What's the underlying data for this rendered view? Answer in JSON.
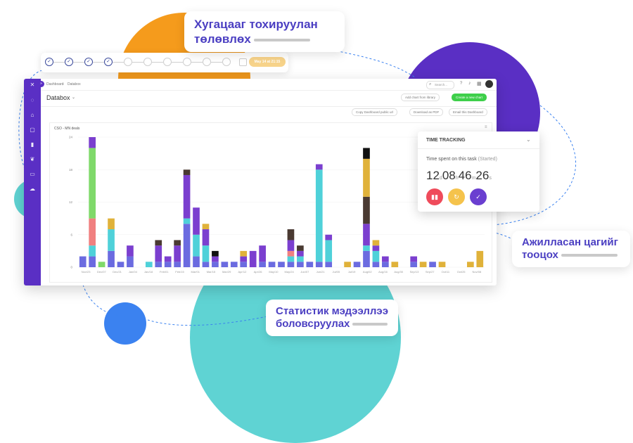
{
  "callouts": {
    "plan_line1": "Хугацааг тохируулан",
    "plan_line2": "төлөвлөх",
    "track_line1": "Ажилласан цагийг",
    "track_line2": "тооцох",
    "stats_line1": "Статистик мэдээллээ",
    "stats_line2": "боловсруулах"
  },
  "stepper": {
    "completed_steps": 4,
    "total_steps": 10,
    "date_badge": "May 14 at 21:15"
  },
  "app": {
    "breadcrumb": [
      "Dashboard",
      "Databox"
    ],
    "search_placeholder": "Search...",
    "page_title": "Databox",
    "add_chart_label": "Add chart from library",
    "create_chart_label": "Create a new chart",
    "copy_link_label": "Copy Dashboard public url",
    "download_pdf_label": "Download as PDF",
    "email_label": "Email this Dashboard"
  },
  "time_tracking": {
    "header": "TIME TRACKING",
    "spent_label": "Time spent on this task",
    "status": "(Started)",
    "days": "12",
    "days_unit": "d",
    "hours": "08",
    "hours_unit": "h",
    "minutes": "46",
    "minutes_unit": "m",
    "seconds": "26",
    "seconds_unit": "s"
  },
  "colors": {
    "accent_purple": "#5a2fc4",
    "green_button": "#3ecf4a",
    "stop_red": "#ef4b5b",
    "pause_yellow": "#f5c34c",
    "done_purple": "#6a3fd0"
  },
  "chart_data": {
    "type": "bar",
    "stacked": true,
    "title": "CSO - MN deals",
    "ylim": [
      0,
      24
    ],
    "yticks": [
      0,
      6,
      12,
      18,
      24
    ],
    "xticklabels": [
      "Nov/23",
      "Dec/07",
      "Dec/21",
      "Jan/04",
      "Jan/18",
      "Feb/01",
      "Feb/15",
      "Mar/01",
      "Mar/15",
      "Mar/29",
      "Apr/12",
      "Apr/26",
      "May/10",
      "May/24",
      "Jun/07",
      "Jun/21",
      "Jul/05",
      "Jul/19",
      "Aug/02",
      "Aug/16",
      "Aug/30",
      "Sep/13",
      "Sep/27",
      "Oct/11",
      "Oct/25",
      "Nov/08"
    ],
    "series_colors": [
      "#6b6be0",
      "#4fd1d9",
      "#f08080",
      "#7fd96a",
      "#7b3fcf",
      "#4a3a32",
      "#e0b23a",
      "#111111"
    ],
    "bars": [
      [
        2,
        0,
        0,
        0,
        0,
        0,
        0,
        0
      ],
      [
        2,
        2,
        5,
        13,
        2,
        0,
        0,
        0
      ],
      [
        0,
        0,
        0,
        1,
        0,
        0,
        0,
        0
      ],
      [
        3,
        4,
        0,
        0,
        0,
        0,
        2,
        0
      ],
      [
        1,
        0,
        0,
        0,
        0,
        0,
        0,
        0
      ],
      [
        2,
        0,
        0,
        0,
        2,
        0,
        0,
        0
      ],
      [
        0,
        0,
        0,
        0,
        0,
        0,
        0,
        0
      ],
      [
        0,
        1,
        0,
        0,
        0,
        0,
        0,
        0
      ],
      [
        1,
        0,
        0,
        0,
        3,
        1,
        0,
        0
      ],
      [
        1,
        0,
        0,
        0,
        1,
        0,
        0,
        0
      ],
      [
        1,
        0,
        0,
        0,
        3,
        1,
        0,
        0
      ],
      [
        8,
        1,
        0,
        0,
        8,
        1,
        0,
        0
      ],
      [
        2,
        4,
        0,
        0,
        5,
        0,
        0,
        0
      ],
      [
        1,
        3,
        0,
        0,
        3,
        0,
        1,
        0
      ],
      [
        1,
        0,
        0,
        0,
        1,
        0,
        0,
        1
      ],
      [
        1,
        0,
        0,
        0,
        0,
        0,
        0,
        0
      ],
      [
        1,
        0,
        0,
        0,
        0,
        0,
        0,
        0
      ],
      [
        1,
        0,
        0,
        0,
        1,
        0,
        1,
        0
      ],
      [
        0,
        0,
        0,
        0,
        3,
        0,
        0,
        0
      ],
      [
        1,
        0,
        0,
        0,
        3,
        0,
        0,
        0
      ],
      [
        1,
        0,
        0,
        0,
        0,
        0,
        0,
        0
      ],
      [
        1,
        0,
        0,
        0,
        0,
        0,
        0,
        0
      ],
      [
        1,
        1,
        1,
        0,
        2,
        2,
        0,
        0
      ],
      [
        1,
        1,
        0,
        0,
        1,
        1,
        0,
        0
      ],
      [
        1,
        0,
        0,
        0,
        0,
        0,
        0,
        0
      ],
      [
        1,
        17,
        0,
        0,
        1,
        0,
        0,
        0
      ],
      [
        1,
        4,
        0,
        0,
        1,
        0,
        0,
        0
      ],
      [
        0,
        0,
        0,
        0,
        0,
        0,
        0,
        0
      ],
      [
        0,
        0,
        0,
        0,
        0,
        0,
        1,
        0
      ],
      [
        1,
        0,
        0,
        0,
        0,
        0,
        0,
        0
      ],
      [
        3,
        1,
        0,
        0,
        4,
        5,
        7,
        2
      ],
      [
        1,
        2,
        0,
        0,
        1,
        0,
        1,
        0
      ],
      [
        1,
        0,
        0,
        0,
        1,
        0,
        0,
        0
      ],
      [
        0,
        0,
        0,
        0,
        0,
        0,
        1,
        0
      ],
      [
        0,
        0,
        0,
        0,
        0,
        0,
        0,
        0
      ],
      [
        1,
        0,
        0,
        0,
        1,
        0,
        0,
        0
      ],
      [
        0,
        0,
        0,
        0,
        0,
        0,
        1,
        0
      ],
      [
        1,
        0,
        0,
        0,
        0,
        0,
        0,
        0
      ],
      [
        0,
        0,
        0,
        0,
        0,
        0,
        1,
        0
      ],
      [
        0,
        0,
        0,
        0,
        0,
        0,
        0,
        0
      ],
      [
        0,
        0,
        0,
        0,
        0,
        0,
        0,
        0
      ],
      [
        0,
        0,
        0,
        0,
        0,
        0,
        1,
        0
      ],
      [
        0,
        0,
        0,
        0,
        0,
        0,
        3,
        0
      ]
    ]
  }
}
